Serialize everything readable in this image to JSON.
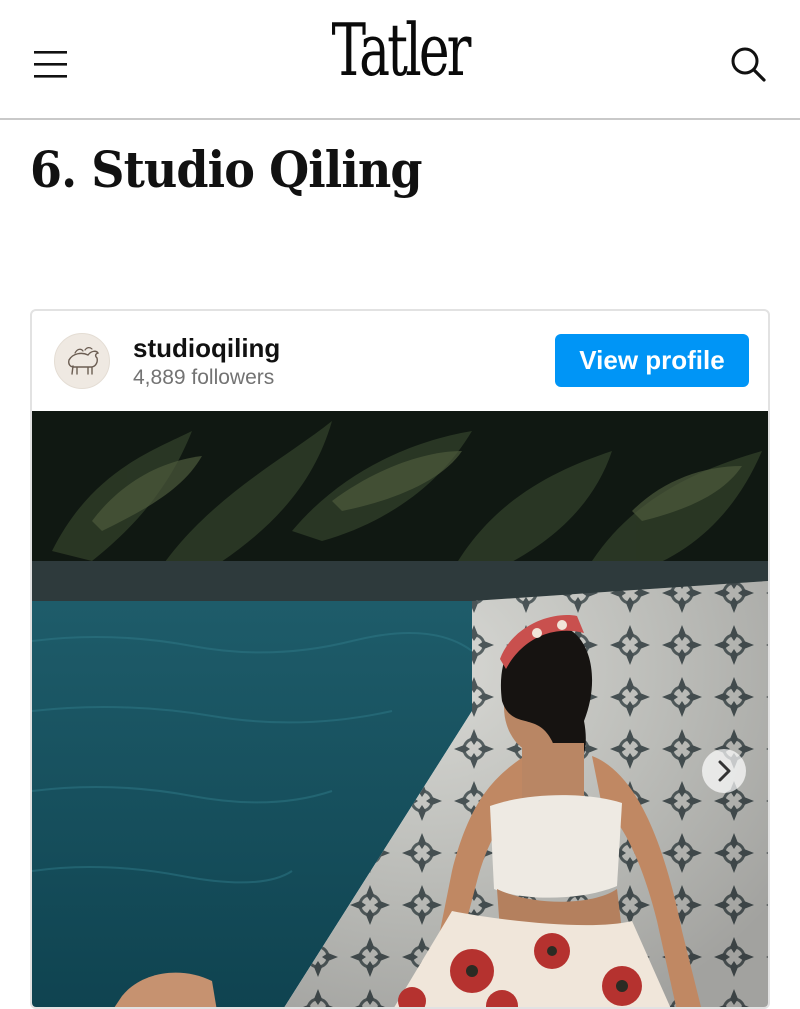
{
  "header": {
    "logo": "Tatler",
    "menu_icon": "hamburger-menu-icon",
    "search_icon": "search-icon"
  },
  "article": {
    "heading": "6. Studio Qiling"
  },
  "instagram_embed": {
    "username": "studioqiling",
    "followers": "4,889 followers",
    "view_profile_label": "View profile",
    "avatar_icon": "qilin-logo-icon",
    "next_icon": "chevron-right-icon",
    "button_color": "#0095f6"
  }
}
